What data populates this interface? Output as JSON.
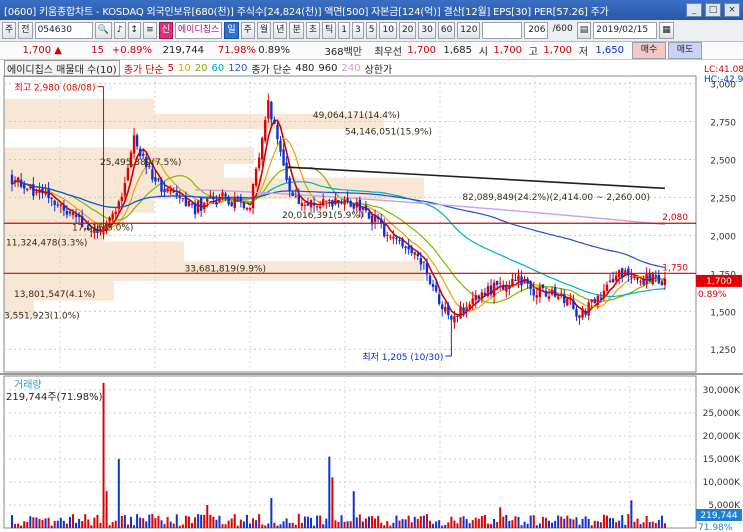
{
  "window": {
    "title": "[0600] 키움종합차트 - KOSDAQ 외국인보유[680(천)] 주식수[24,824(천)] 액면[500] 자본금[124(억)] 결산[12월] EPS[30] PER[57.26] 주가",
    "btn_minimize": "_",
    "btn_restore": "□",
    "btn_close": "×"
  },
  "toolbar": {
    "tab1": "주",
    "tab2": "전",
    "code": "054630",
    "stock_badge": "신",
    "stock_name": "에이디칩스",
    "period_buttons": [
      "일",
      "주",
      "월",
      "년",
      "분",
      "초",
      "틱"
    ],
    "minute_buttons": [
      "1",
      "3",
      "5",
      "10",
      "20",
      "30",
      "60",
      "120"
    ],
    "count": "206",
    "count_total": "/600",
    "date": "2019/02/15"
  },
  "price": {
    "current": "1,700 ▲",
    "change": "15",
    "change_pct": "+0.89%",
    "volume": "219,744",
    "volume_pct": "71.98%",
    "turnover_pct": "0.89%",
    "trade_amount": "368백만",
    "prev_label": "최우선",
    "prev_value": "1,700",
    "open": "1,685",
    "open_label": "시",
    "high_label": "고",
    "high_value": "1,700",
    "low_label": "저",
    "low_value": "1,650",
    "buy_button": "매수",
    "sell_button": "매도"
  },
  "legend": {
    "title": "에이디칩스 매물대 수(10)",
    "ma_label": "종가 단순",
    "ma_values": [
      "5",
      "10",
      "20",
      "60",
      "120"
    ],
    "ma2_label": "종가 단순",
    "ma2_values": [
      "480",
      "960",
      "240"
    ],
    "upper_label": "상한가",
    "lc": "LC:41.08",
    "hc": "HC:-42.95"
  },
  "chart_data": {
    "type": "candlestick",
    "y_axis_ticks": [
      "3,000",
      "2,750",
      "2,500",
      "2,250",
      "2,000",
      "1,750",
      "1,500",
      "1,250"
    ],
    "ylim": [
      1100,
      3050
    ],
    "current_price": "1,700",
    "current_pct": "0.89%",
    "ref_lines": [
      {
        "value": 2080,
        "label": "2,080"
      },
      {
        "value": 1750,
        "label": "1,750"
      }
    ],
    "annotations": {
      "high": "최고 2,980 (08/08)",
      "low": "최저 1,205 (10/30)"
    },
    "volume_profile": [
      {
        "label": "49,064,171(14.4%)"
      },
      {
        "label": "54,146,051(15.9%)"
      },
      {
        "label": "25,495,389(7.5%)"
      },
      {
        "label": "82,089,849(24.2%)(2,414.00 ~ 2,260.00)"
      },
      {
        "label": "20,016,391(5.9%)"
      },
      {
        "label": "17,016(5.0%)"
      },
      {
        "label": "11,324,478(3.3%)"
      },
      {
        "label": "33,681,819(9.9%)"
      },
      {
        "label": "13,801,547(4.1%)"
      },
      {
        "label": "3,551,923(1.0%)"
      }
    ],
    "volume_panel": {
      "title": "거래량",
      "value": "219,744주(71.98%)",
      "y_ticks": [
        "30,000K",
        "25,000K",
        "20,000K",
        "15,000K",
        "10,000K",
        "5,000K"
      ],
      "current_value": "219,744",
      "current_pct": "71.98%"
    }
  }
}
